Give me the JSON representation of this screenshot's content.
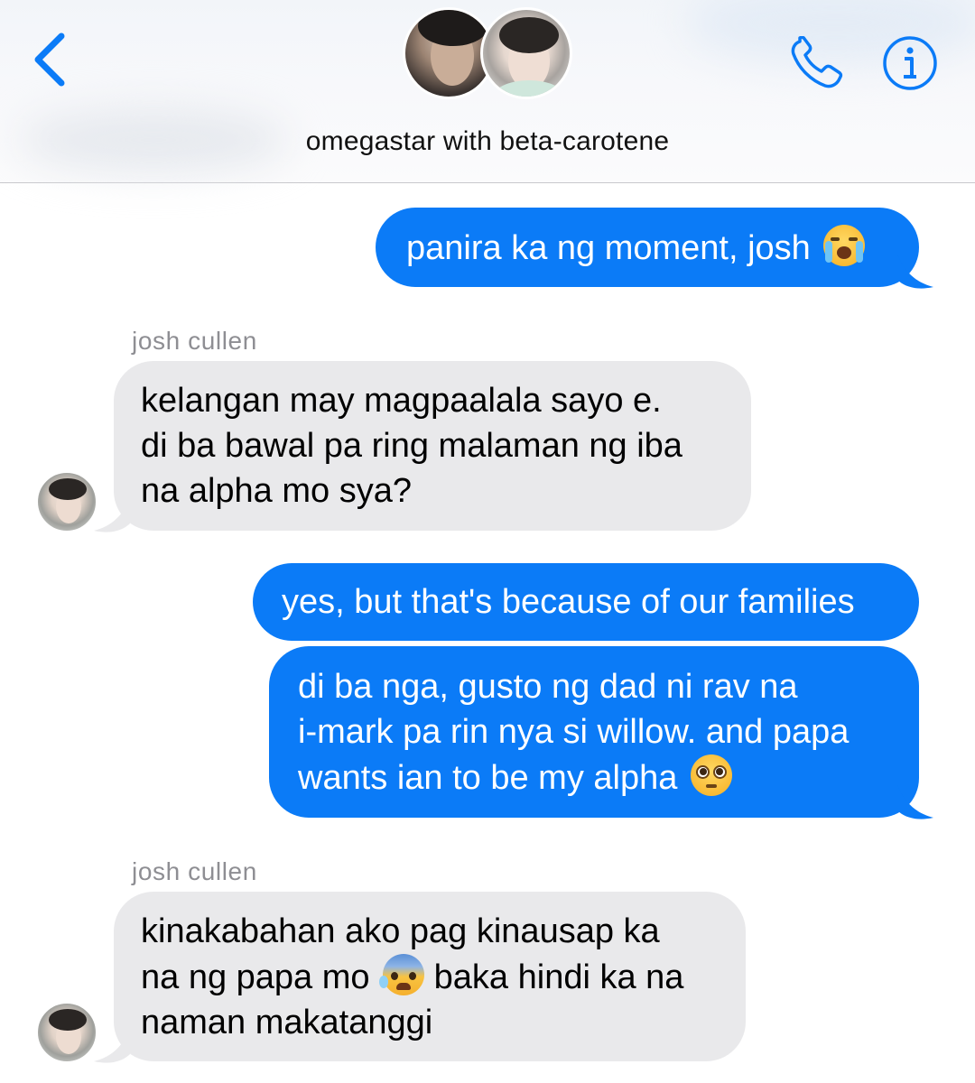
{
  "header": {
    "title": "omegastar with beta-carotene",
    "back_icon": "chevron-left-icon",
    "call_icon": "phone-icon",
    "info_icon": "info-icon",
    "accent": "#0b7bf7"
  },
  "messages": [
    {
      "direction": "outgoing",
      "lines": [
        "panira ka ng moment, josh"
      ],
      "emoji": "loudly-crying-face"
    },
    {
      "direction": "incoming",
      "sender": "josh cullen",
      "lines": [
        "kelangan may magpaalala sayo e.",
        "di ba bawal pa ring malaman ng iba",
        "na alpha mo sya?"
      ]
    },
    {
      "direction": "outgoing",
      "lines": [
        "yes, but that's because of our families"
      ]
    },
    {
      "direction": "outgoing",
      "lines": [
        "di ba nga, gusto ng dad ni rav na",
        "i-mark pa rin nya si willow. and papa",
        "wants ian to be my alpha"
      ],
      "emoji": "pleading-face"
    },
    {
      "direction": "incoming",
      "sender": "josh cullen",
      "lines": [
        "kinakabahan ako pag kinausap ka",
        "na ng papa mo",
        "baka hindi ka na",
        "naman makatanggi"
      ],
      "emoji": "anxious-face-with-sweat"
    }
  ],
  "colors": {
    "outgoing_bubble": "#0b7bf7",
    "incoming_bubble": "#e9e9eb",
    "sender_text": "#8e8e93"
  }
}
